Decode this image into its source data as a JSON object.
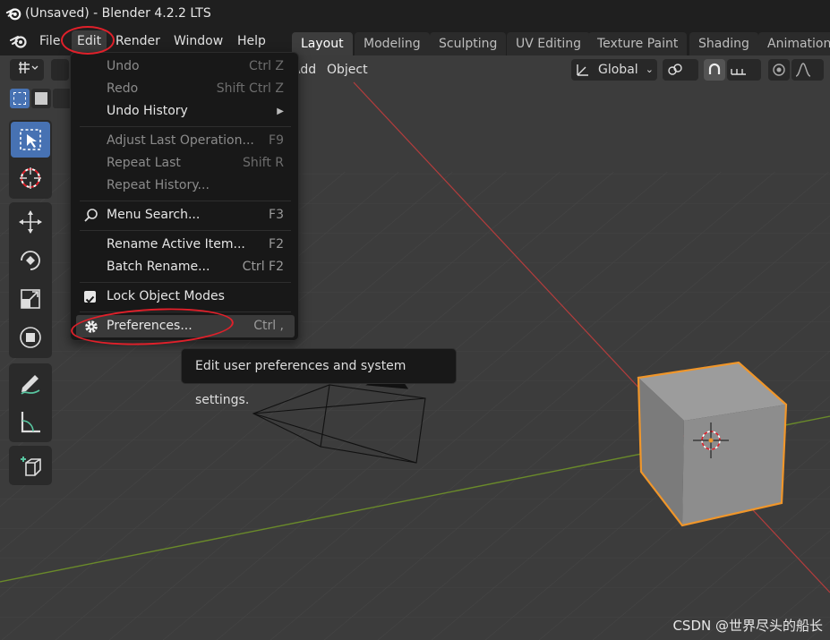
{
  "window": {
    "title": "(Unsaved) - Blender 4.2.2 LTS"
  },
  "menubar": {
    "file": "File",
    "edit": "Edit",
    "render": "Render",
    "window": "Window",
    "help": "Help"
  },
  "workspaces": [
    "Layout",
    "Modeling",
    "Sculpting",
    "UV Editing",
    "Texture Paint",
    "Shading",
    "Animation"
  ],
  "viewport_header": {
    "add": "Add",
    "object": "Object",
    "orientation": "Global"
  },
  "edit_menu": {
    "undo": {
      "label": "Undo",
      "shortcut": "Ctrl Z"
    },
    "redo": {
      "label": "Redo",
      "shortcut": "Shift Ctrl Z"
    },
    "undo_history": {
      "label": "Undo History"
    },
    "adjust_last": {
      "label": "Adjust Last Operation...",
      "shortcut": "F9"
    },
    "repeat_last": {
      "label": "Repeat Last",
      "shortcut": "Shift R"
    },
    "repeat_history": {
      "label": "Repeat History..."
    },
    "menu_search": {
      "label": "Menu Search...",
      "shortcut": "F3"
    },
    "rename_active": {
      "label": "Rename Active Item...",
      "shortcut": "F2"
    },
    "batch_rename": {
      "label": "Batch Rename...",
      "shortcut": "Ctrl F2"
    },
    "lock_object_modes": {
      "label": "Lock Object Modes",
      "checked": true
    },
    "preferences": {
      "label": "Preferences...",
      "shortcut": "Ctrl ,"
    }
  },
  "tooltip": {
    "text": "Edit user preferences and system settings."
  },
  "watermark": {
    "text": "CSDN @世界尽头的船长"
  },
  "colors": {
    "accent": "#4772b3",
    "annotation": "#e0202a",
    "selection": "#f0962a",
    "x_axis": "#b43c3c",
    "y_axis": "#6a8a2a"
  },
  "active_workspace": "Layout"
}
